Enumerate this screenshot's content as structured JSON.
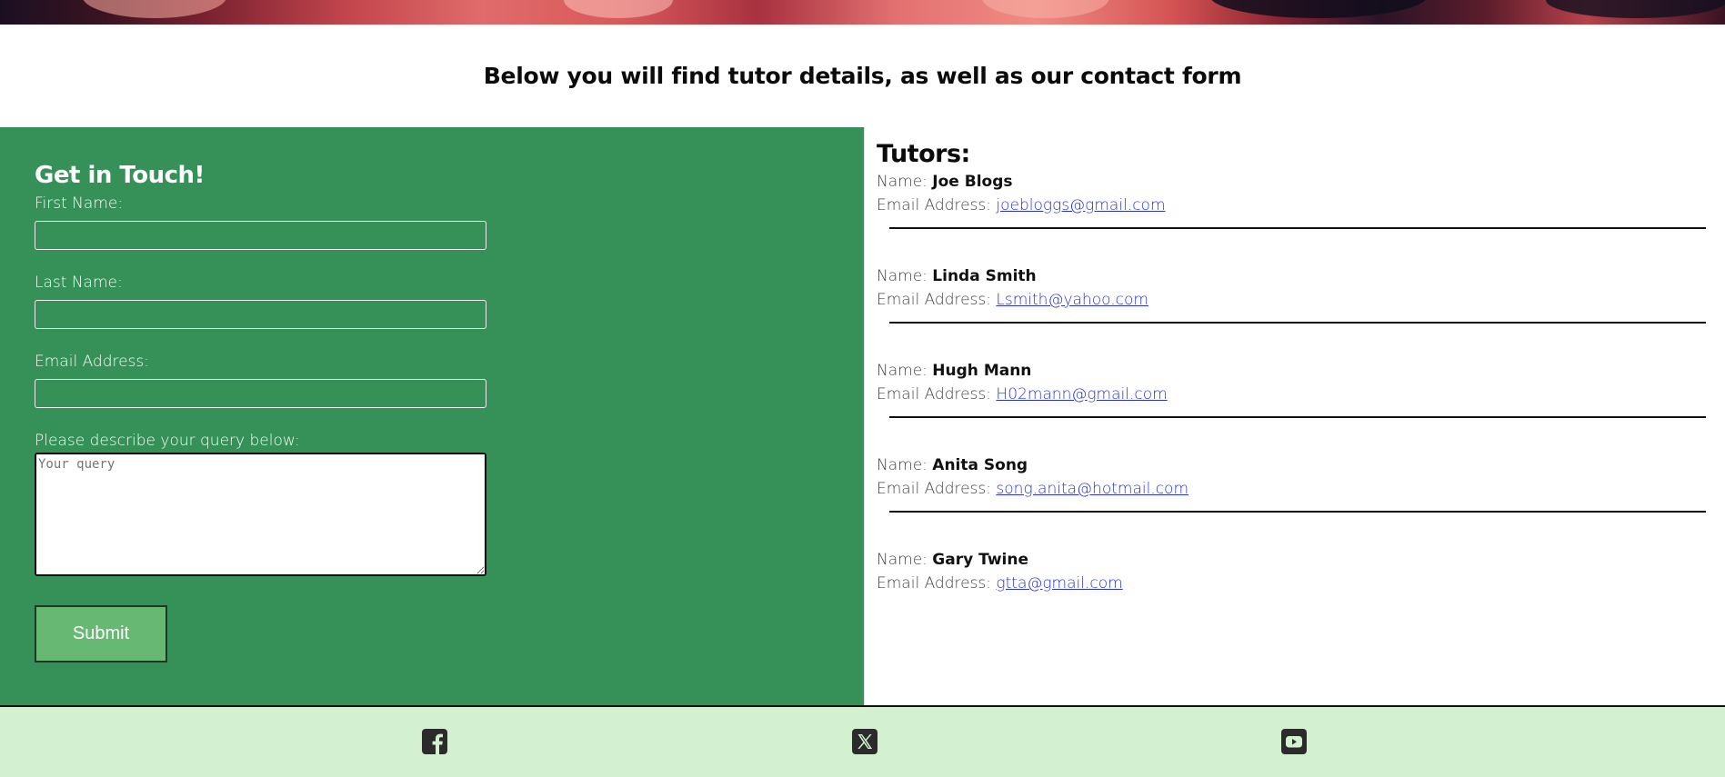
{
  "intro": {
    "heading": "Below you will find tutor details, as well as our contact form"
  },
  "contact_form": {
    "title": "Get in Touch!",
    "first_name_label": "First Name:",
    "first_name_value": "",
    "last_name_label": "Last Name:",
    "last_name_value": "",
    "email_label": "Email Address:",
    "email_value": "",
    "query_label": "Please describe your query below:",
    "query_placeholder": "Your query",
    "submit_label": "Submit"
  },
  "tutors": {
    "title": "Tutors:",
    "name_prefix": "Name:",
    "email_prefix": "Email Address:",
    "items": [
      {
        "name": "Joe Blogs",
        "email": "joebloggs@gmail.com"
      },
      {
        "name": "Linda Smith",
        "email": "Lsmith@yahoo.com"
      },
      {
        "name": "Hugh Mann",
        "email": "H02mann@gmail.com"
      },
      {
        "name": "Anita Song",
        "email": "song.anita@hotmail.com"
      },
      {
        "name": "Gary Twine",
        "email": "gtta@gmail.com"
      }
    ]
  },
  "footer": {
    "icons": [
      "facebook-icon",
      "x-twitter-icon",
      "youtube-icon"
    ]
  },
  "colors": {
    "form_panel": "#359157",
    "submit_button": "#67b872",
    "footer": "#d3f0d0",
    "link": "#2a35d4"
  }
}
